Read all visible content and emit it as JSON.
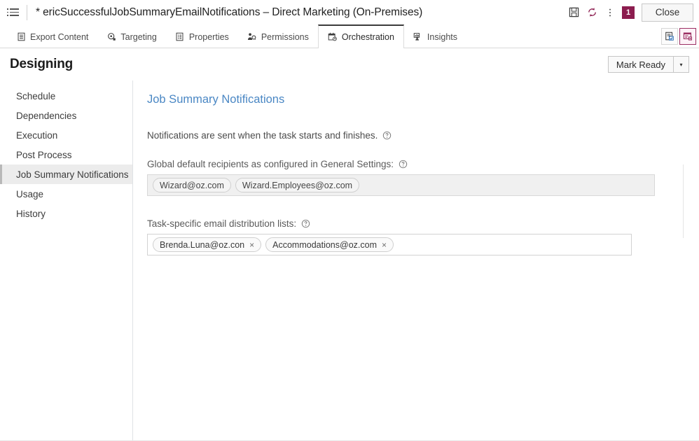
{
  "titlebar": {
    "menu_icon": "hamburger-icon",
    "title": "* ericSuccessfulJobSummaryEmailNotifications – Direct Marketing (On-Premises)",
    "save_icon": "save-icon",
    "refresh_icon": "refresh-icon",
    "more_icon": "more-vertical-icon",
    "badge_count": "1",
    "close_label": "Close"
  },
  "tabs": [
    {
      "label": "Export Content",
      "icon": "export-content-icon",
      "active": false
    },
    {
      "label": "Targeting",
      "icon": "targeting-icon",
      "active": false
    },
    {
      "label": "Properties",
      "icon": "properties-icon",
      "active": false
    },
    {
      "label": "Permissions",
      "icon": "permissions-icon",
      "active": false
    },
    {
      "label": "Orchestration",
      "icon": "orchestration-icon",
      "active": true
    },
    {
      "label": "Insights",
      "icon": "insights-icon",
      "active": false
    }
  ],
  "tabbar_buttons": [
    {
      "name": "properties-view-button",
      "selected": false
    },
    {
      "name": "orchestration-view-button",
      "selected": true
    }
  ],
  "page": {
    "title": "Designing",
    "mark_ready_label": "Mark Ready",
    "mark_ready_arrow": "▾"
  },
  "sidebar": {
    "items": [
      {
        "label": "Schedule",
        "active": false
      },
      {
        "label": "Dependencies",
        "active": false
      },
      {
        "label": "Execution",
        "active": false
      },
      {
        "label": "Post Process",
        "active": false
      },
      {
        "label": "Job Summary Notifications",
        "active": true
      },
      {
        "label": "Usage",
        "active": false
      },
      {
        "label": "History",
        "active": false
      }
    ]
  },
  "main": {
    "section_title": "Job Summary Notifications",
    "description": "Notifications are sent when the task starts and finishes.",
    "global_label": "Global default recipients as configured in General Settings:",
    "global_recipients": [
      "Wizard@oz.com",
      "Wizard.Employees@oz.com"
    ],
    "task_label": "Task-specific email distribution lists:",
    "task_recipients": [
      {
        "email": "Brenda.Luna@oz.con",
        "remove": "×"
      },
      {
        "email": "Accommodations@oz.com",
        "remove": "×"
      }
    ],
    "help_icon": "help-circle-icon"
  },
  "colors": {
    "accent_blue": "#4a87c4",
    "badge_magenta": "#8c1d4f",
    "selected_border": "#9c2f63",
    "sidebar_active_bg": "#ececec"
  }
}
